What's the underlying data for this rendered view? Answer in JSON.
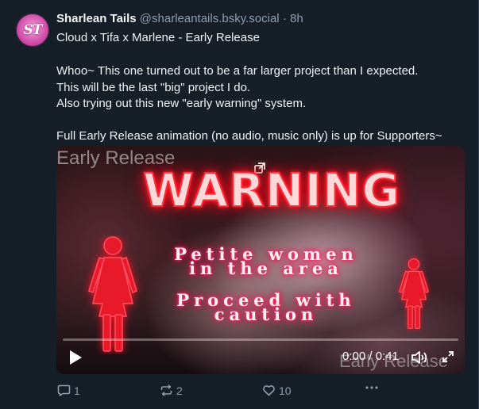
{
  "author": {
    "avatar_initials": "ST",
    "display_name": "Sharlean Tails",
    "handle": "@sharleantails.bsky.social",
    "separator": "·",
    "time_ago": "8h"
  },
  "post": {
    "title": "Cloud x Tifa x Marlene - Early Release",
    "body_lines": [
      "Whoo~ This one turned out to be a far larger project than I expected.",
      "This will be the last \"big\" project I do.",
      "Also trying out this new \"early warning\" system.",
      "",
      "Full Early Release animation (no audio, music only) is up for Supporters~"
    ]
  },
  "video": {
    "corner_text": "Early Release",
    "warning_title": "WARNING",
    "warning_line1": "Petite women",
    "warning_line2": "in the area",
    "warning_line3": "Proceed with",
    "warning_line4": "caution",
    "watermark": "Early Release",
    "time": "0:00 / 0:41",
    "progress": 0.0,
    "icons": {
      "expand": "expand-icon",
      "play": "play-icon",
      "volume": "volume-icon",
      "fullscreen": "fullscreen-icon"
    }
  },
  "actions": {
    "reply_count": "1",
    "repost_count": "2",
    "like_count": "10",
    "icons": {
      "reply": "reply-icon",
      "repost": "repost-icon",
      "like": "heart-icon",
      "more": "more-icon"
    }
  },
  "colors": {
    "background": "#161e27",
    "text": "#f1f3f5",
    "muted": "#8d9eb0",
    "neon_red": "#ff2a3a",
    "neon_pink": "#ff1050"
  }
}
